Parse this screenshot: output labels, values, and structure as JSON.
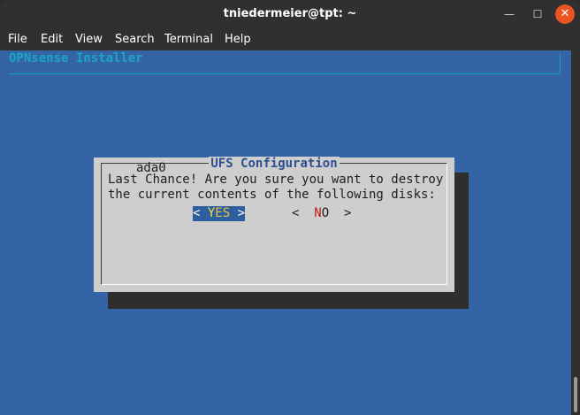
{
  "window": {
    "title": "tniedermeier@tpt: ~",
    "minimize_glyph": "—",
    "maximize_glyph": "☐",
    "close_glyph": "✕"
  },
  "menu": [
    "File",
    "Edit",
    "View",
    "Search",
    "Terminal",
    "Help"
  ],
  "terminal": {
    "installer_title": "OPNsense Installer",
    "dialog": {
      "title": "UFS Configuration",
      "line1": "Last Chance! Are you sure you want to destroy",
      "line2": "the current contents of the following disks:",
      "disk": "ada0",
      "yes": {
        "left": "< ",
        "hotkey": "Y",
        "rest": "ES",
        "right": " >"
      },
      "no": {
        "left": "<  ",
        "hotkey": "N",
        "rest": "O",
        "right": "  >"
      }
    }
  },
  "colors": {
    "terminal_bg": "#3464a5",
    "dialog_bg": "#cecece",
    "accent_cyan": "#1aa5c6",
    "close_button": "#e95420"
  }
}
